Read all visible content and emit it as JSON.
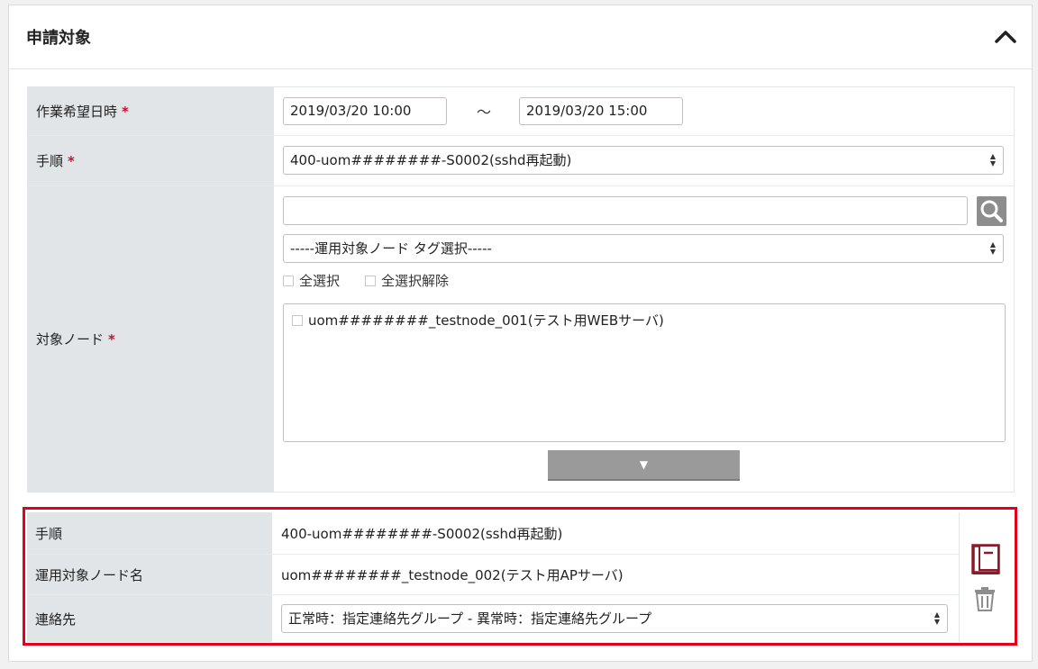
{
  "panel": {
    "title": "申請対象"
  },
  "fields": {
    "datetime": {
      "label": "作業希望日時",
      "required_mark": "*",
      "start_value": "2019/03/20 10:00",
      "separator": "～",
      "end_value": "2019/03/20 15:00"
    },
    "procedure": {
      "label": "手順",
      "required_mark": "*",
      "selected": "400-uom########-S0002(sshd再起動)"
    },
    "target_node": {
      "label": "対象ノード",
      "required_mark": "*",
      "search_value": "",
      "tag_select": "-----運用対象ノード タグ選択-----",
      "select_all": "全選択",
      "deselect_all": "全選択解除",
      "nodes": [
        {
          "label": "uom########_testnode_001(テスト用WEBサーバ)",
          "checked": false
        }
      ],
      "expand_symbol": "▼"
    }
  },
  "entry": {
    "procedure_label": "手順",
    "procedure_value": "400-uom########-S0002(sshd再起動)",
    "node_label": "運用対象ノード名",
    "node_value": "uom########_testnode_002(テスト用APサーバ)",
    "contact_label": "連絡先",
    "contact_value": "正常時：指定連絡先グループ - 異常時：指定連絡先グループ"
  },
  "colors": {
    "highlight": "#e3001b",
    "required": "#c8102e",
    "label_bg": "#e1e5e8",
    "book_icon": "#8b1a2b"
  }
}
